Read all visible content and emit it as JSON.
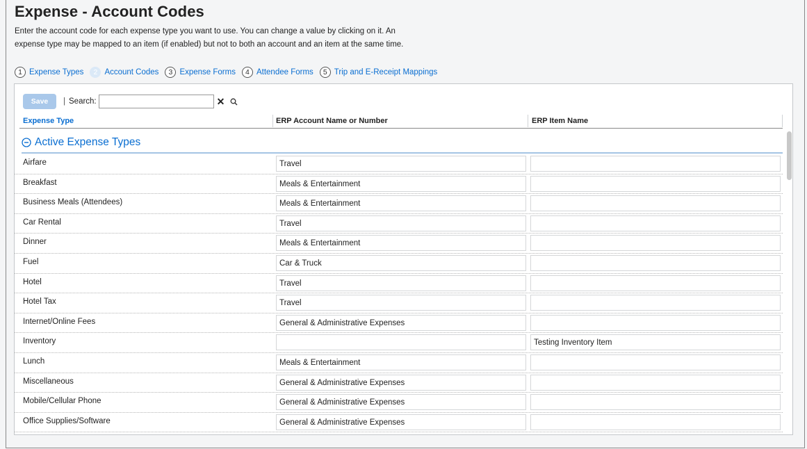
{
  "header": {
    "title": "Expense - Account Codes",
    "desc_line1": "Enter the account code for each expense type you want to use. You can change a value by clicking on it. An",
    "desc_line2": "expense type may be mapped to an item (if enabled) but not to both an account and an item at the same time."
  },
  "steps": [
    {
      "num": "1",
      "label": "Expense Types"
    },
    {
      "num": "2",
      "label": "Account Codes"
    },
    {
      "num": "3",
      "label": "Expense Forms"
    },
    {
      "num": "4",
      "label": "Attendee Forms"
    },
    {
      "num": "5",
      "label": "Trip and E-Receipt Mappings"
    }
  ],
  "toolbar": {
    "save_label": "Save",
    "separator": "|",
    "search_label": "Search:",
    "search_value": ""
  },
  "table": {
    "columns": [
      "Expense Type",
      "ERP Account Name or Number",
      "ERP Item Name"
    ],
    "group_label": "Active Expense Types",
    "rows": [
      {
        "type": "Airfare",
        "account": "Travel",
        "item": ""
      },
      {
        "type": "Breakfast",
        "account": "Meals & Entertainment",
        "item": ""
      },
      {
        "type": "Business Meals (Attendees)",
        "account": "Meals & Entertainment",
        "item": ""
      },
      {
        "type": "Car Rental",
        "account": "Travel",
        "item": ""
      },
      {
        "type": "Dinner",
        "account": "Meals & Entertainment",
        "item": ""
      },
      {
        "type": "Fuel",
        "account": "Car & Truck",
        "item": ""
      },
      {
        "type": "Hotel",
        "account": "Travel",
        "item": ""
      },
      {
        "type": "Hotel Tax",
        "account": "Travel",
        "item": ""
      },
      {
        "type": "Internet/Online Fees",
        "account": "General & Administrative Expenses",
        "item": ""
      },
      {
        "type": "Inventory",
        "account": "",
        "item": "Testing Inventory Item"
      },
      {
        "type": "Lunch",
        "account": "Meals & Entertainment",
        "item": ""
      },
      {
        "type": "Miscellaneous",
        "account": "General & Administrative Expenses",
        "item": ""
      },
      {
        "type": "Mobile/Cellular Phone",
        "account": "General & Administrative Expenses",
        "item": ""
      },
      {
        "type": "Office Supplies/Software",
        "account": "General & Administrative Expenses",
        "item": ""
      }
    ]
  },
  "icons": {
    "clear": "close-icon",
    "search": "search-icon",
    "collapse": "collapse-circle-icon"
  },
  "colors": {
    "accent": "#0a6ed1",
    "save_button": "#a9c8ea"
  }
}
